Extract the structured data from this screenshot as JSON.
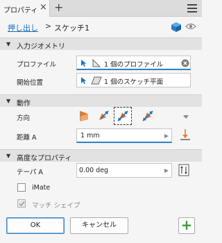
{
  "tab": {
    "label": "プロパティ",
    "close": "×",
    "add": "+"
  },
  "breadcrumb": {
    "link": "押し出し",
    "separator": ">",
    "current": "スケッチ1"
  },
  "input_geometry": {
    "header": "入力ジオメトリ",
    "profile_label": "プロファイル",
    "profile_value": "1 個のプロファイル",
    "profile_clear": "×",
    "start_label": "開始位置",
    "start_value": "1 個のスケッチ平面"
  },
  "behavior": {
    "header": "動作",
    "direction_label": "方向",
    "distance_label": "距離 A",
    "distance_value": "1 mm"
  },
  "advanced": {
    "header": "高度なプロパティ",
    "taper_label": "テーパ A",
    "taper_value": "0.00 deg",
    "imate_label": "iMate",
    "match_shape_label": "マッチ シェイプ"
  },
  "footer": {
    "ok": "OK",
    "cancel": "キャンセル",
    "add": "+"
  },
  "colors": {
    "accent": "#2d7fc7",
    "link": "#1a6fb8",
    "orange": "#e87a2c",
    "green": "#3c9a3c"
  }
}
